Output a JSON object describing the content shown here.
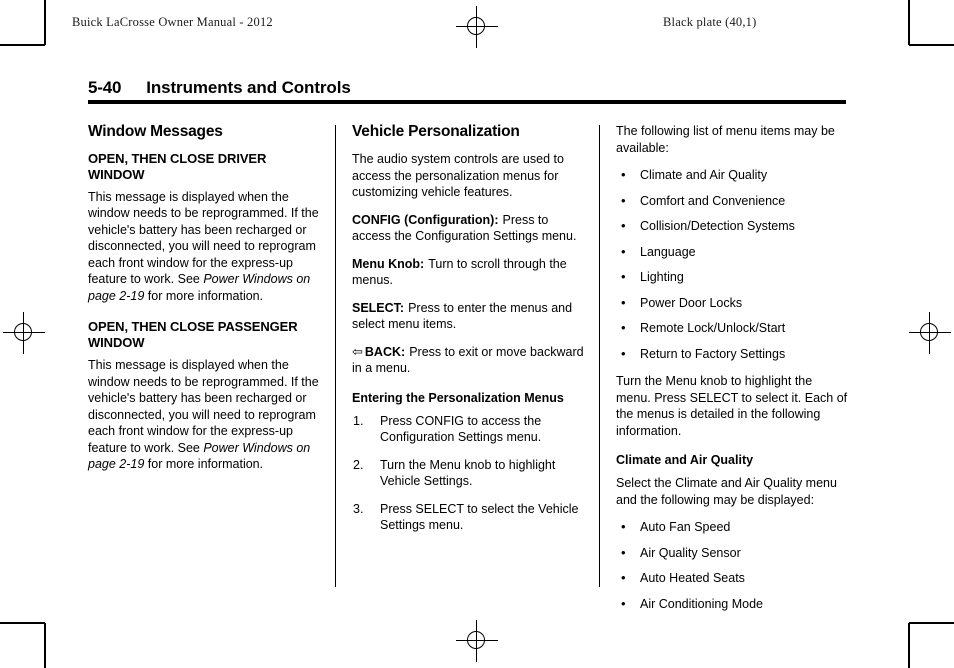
{
  "page": {
    "running_head_left": "Buick LaCrosse Owner Manual - 2012",
    "running_head_right": "Black plate (40,1)",
    "page_number": "5-40",
    "chapter_title": "Instruments and Controls"
  },
  "column1": {
    "section_heading": "Window Messages",
    "sub_heading_1": "OPEN, THEN CLOSE DRIVER WINDOW",
    "paragraph_1_part1": "This message is displayed when the window needs to be reprogrammed. If the vehicle's battery has been recharged or disconnected, you will need to reprogram each front window for the express-up feature to work. See ",
    "paragraph_1_italic": "Power Windows on page 2-19",
    "paragraph_1_part2": " for more information.",
    "sub_heading_2": "OPEN, THEN CLOSE PASSENGER WINDOW",
    "paragraph_2_part1": "This message is displayed when the window needs to be reprogrammed. If the vehicle's battery has been recharged or disconnected, you will need to reprogram each front window for the express-up feature to work. See ",
    "paragraph_2_italic": "Power Windows on page 2-19",
    "paragraph_2_part2": " for more information."
  },
  "column2": {
    "section_heading": "Vehicle Personalization",
    "intro_paragraph": "The audio system controls are used to access the personalization menus for customizing vehicle features.",
    "config_term": "CONFIG (Configuration):",
    "config_desc": "Press to access the Configuration Settings menu.",
    "menuknob_term": "Menu Knob:",
    "menuknob_desc": "Turn to scroll through the menus.",
    "select_term": "SELECT:",
    "select_desc": "Press to enter the menus and select menu items.",
    "back_icon": "back-arrow-icon",
    "back_glyph": "⇦",
    "back_term": "BACK:",
    "back_desc": "Press to exit or move backward in a menu.",
    "minor_heading": "Entering the Personalization Menus",
    "steps": [
      {
        "num": "1.",
        "text": "Press CONFIG to access the Configuration Settings menu."
      },
      {
        "num": "2.",
        "text": "Turn the Menu knob to highlight Vehicle Settings."
      },
      {
        "num": "3.",
        "text": "Press SELECT to select the Vehicle Settings menu."
      }
    ]
  },
  "column3": {
    "intro_paragraph": "The following list of menu items may be available:",
    "menu_items": [
      "Climate and Air Quality",
      "Comfort and Convenience",
      "Collision/Detection Systems",
      "Language",
      "Lighting",
      "Power Door Locks",
      "Remote Lock/Unlock/Start",
      "Return to Factory Settings"
    ],
    "after_list_paragraph": "Turn the Menu knob to highlight the menu. Press SELECT to select it. Each of the menus is detailed in the following information.",
    "sub_heading": "Climate and Air Quality",
    "sub_paragraph": "Select the Climate and Air Quality menu and the following may be displayed:",
    "climate_items": [
      "Auto Fan Speed",
      "Air Quality Sensor",
      "Auto Heated Seats",
      "Air Conditioning Mode"
    ]
  },
  "bullet_glyph": "•"
}
